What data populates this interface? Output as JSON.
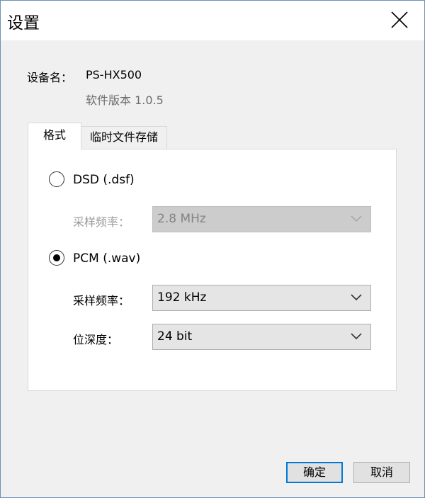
{
  "window": {
    "title": "设置"
  },
  "device": {
    "name_label": "设备名：",
    "name_value": "PS-HX500",
    "version_text": "软件版本 1.0.5"
  },
  "tabs": [
    {
      "label": "格式",
      "active": true
    },
    {
      "label": "临时文件存储",
      "active": false
    }
  ],
  "format": {
    "dsd": {
      "label": "DSD (.dsf)",
      "selected": false,
      "sample_rate_label": "采样频率：",
      "sample_rate_value": "2.8 MHz",
      "enabled": false
    },
    "pcm": {
      "label": "PCM (.wav)",
      "selected": true,
      "sample_rate_label": "采样频率：",
      "sample_rate_value": "192 kHz",
      "bit_depth_label": "位深度：",
      "bit_depth_value": "24 bit"
    }
  },
  "buttons": {
    "ok": "确定",
    "cancel": "取消"
  },
  "icons": {
    "close": "close-icon",
    "dropdown": "chevron-down-icon"
  },
  "colors": {
    "default_button_border": "#0078d7",
    "dialog_bg": "#f0f0f0"
  }
}
